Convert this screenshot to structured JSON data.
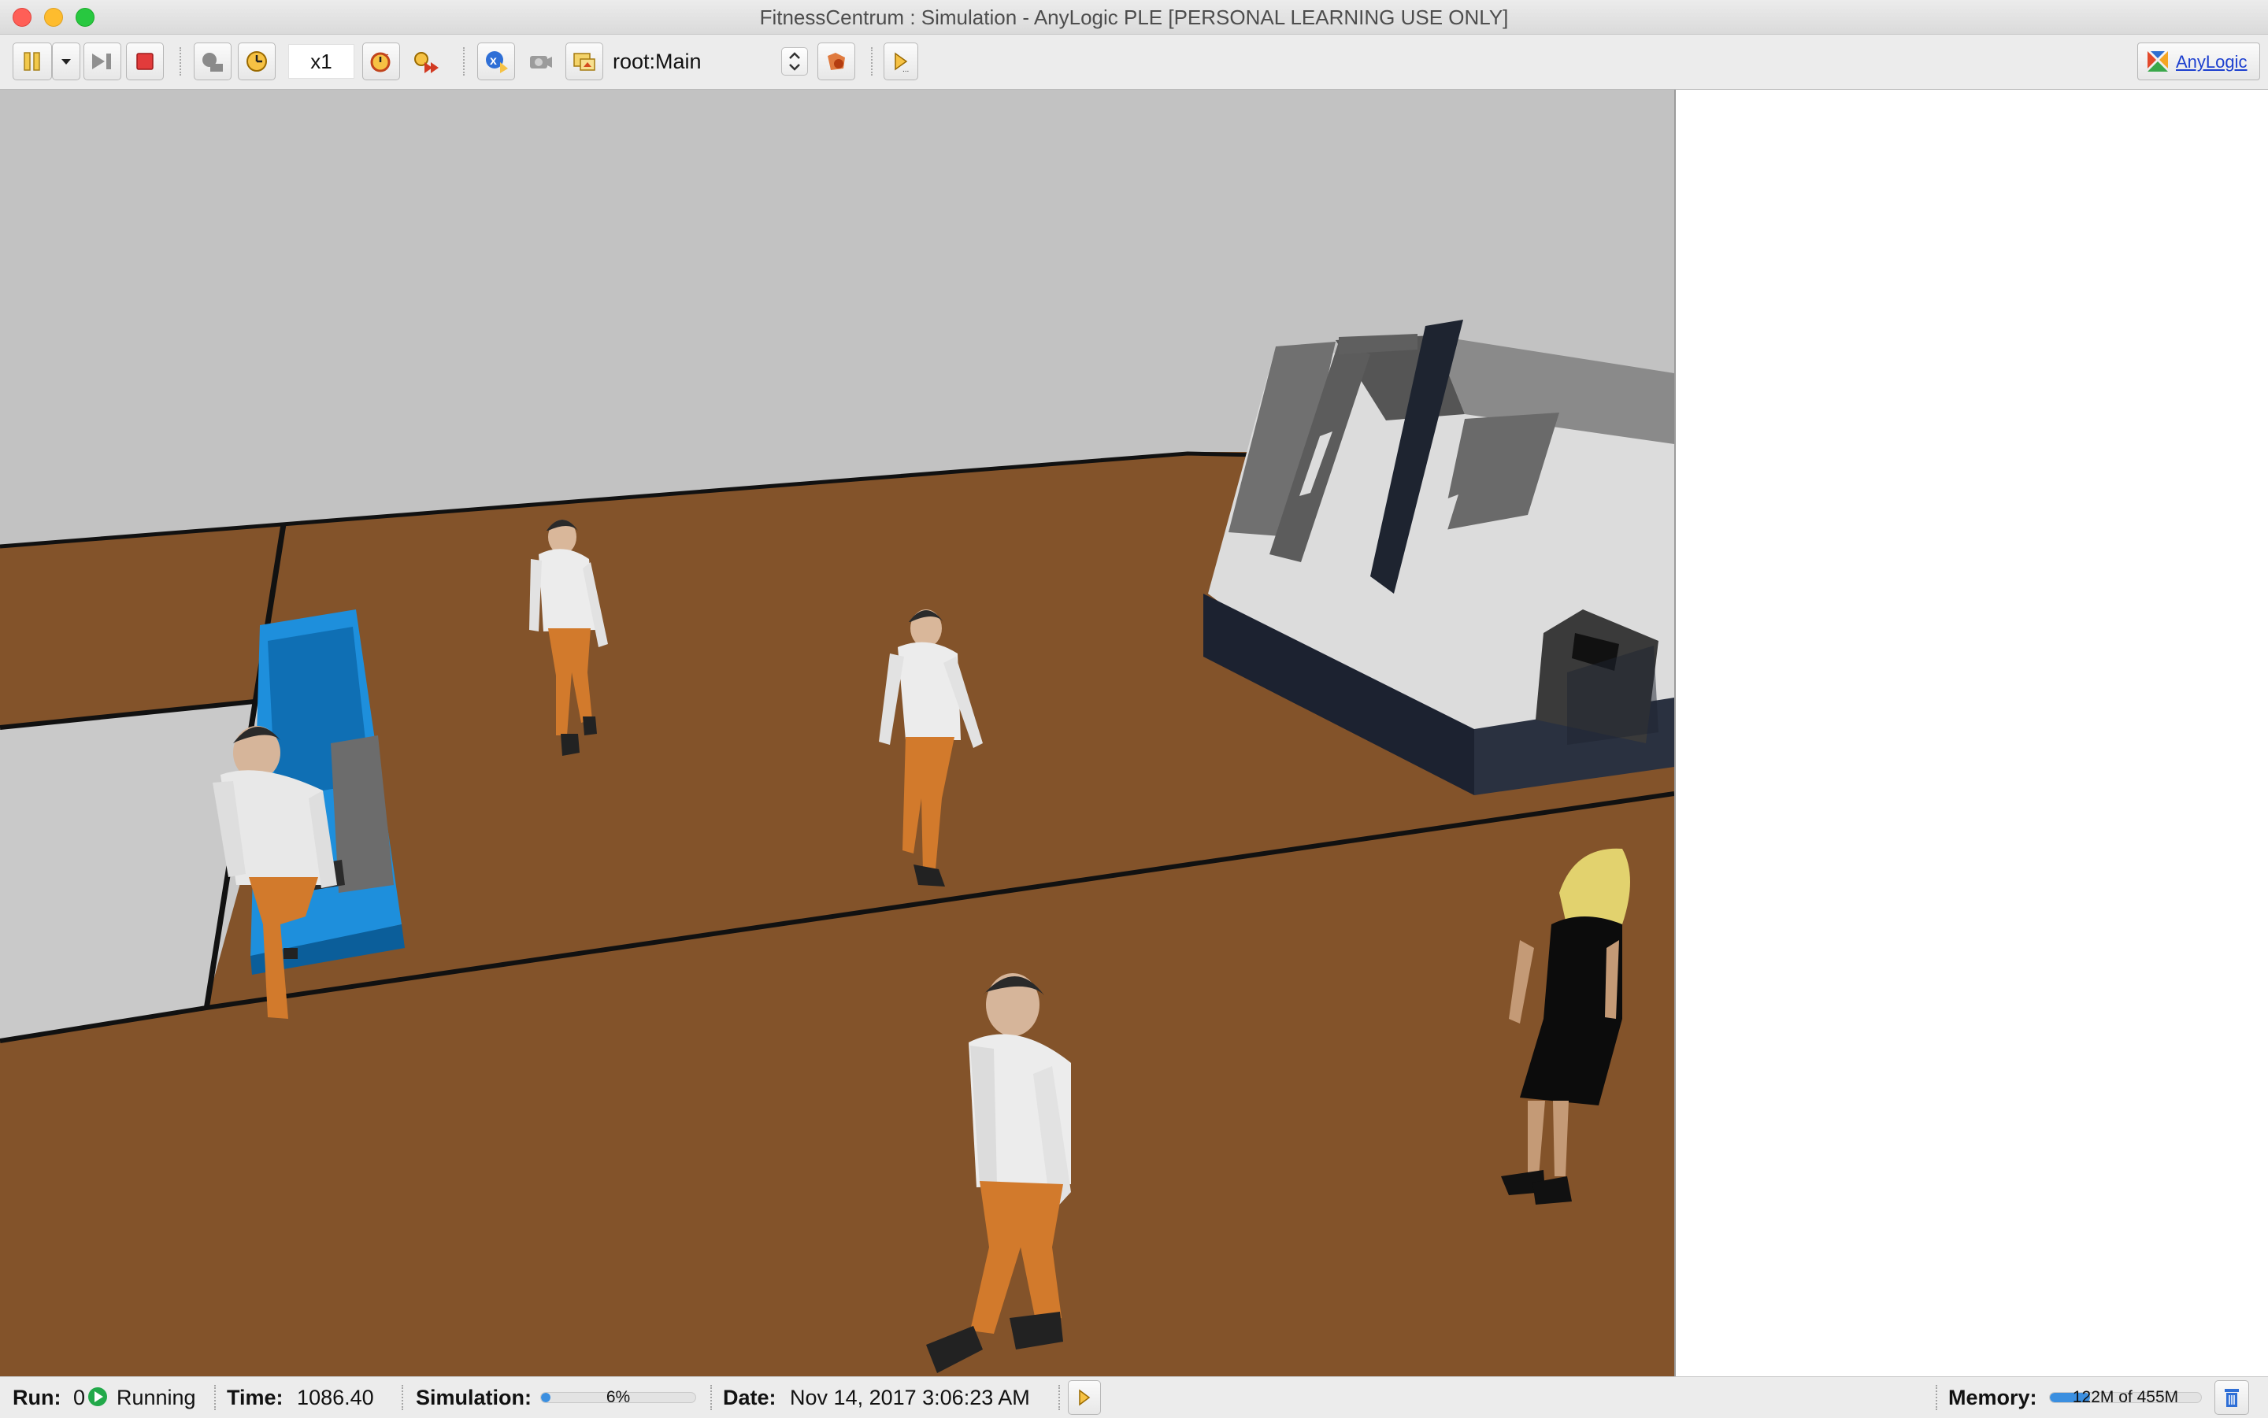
{
  "window": {
    "title": "FitnessCentrum : Simulation - AnyLogic PLE [PERSONAL LEARNING USE ONLY]"
  },
  "toolbar": {
    "speed": "x1",
    "agent_selector": "root:Main",
    "brand_link": "AnyLogic",
    "icons": [
      "run-pause-icon",
      "run-menu-chevron-icon",
      "step-icon",
      "stop-icon",
      "virtual-time-icon",
      "real-time-icon",
      "speed-slower-icon",
      "speed-faster-icon",
      "experiment-icon",
      "camera-icon",
      "navigate-up-icon",
      "navigate-to-agent-icon",
      "developer-panel-icon",
      "anylogic-logo-icon"
    ]
  },
  "status": {
    "run_label": "Run:",
    "run_value": "0",
    "state": "Running",
    "time_label": "Time:",
    "time_value": "1086.40",
    "simulation_label": "Simulation:",
    "simulation_progress_text": "6%",
    "simulation_progress": 0.06,
    "date_label": "Date:",
    "date_value": "Nov 14, 2017 3:06:23 AM",
    "memory_label": "Memory:",
    "memory_text": "122M of 455M",
    "memory_fraction": 0.268
  },
  "colors": {
    "floor": "#83532a",
    "wall": "#bfbfbf",
    "treadmill": "#1e8fdc",
    "machine_gray": "#6e6e6e",
    "progress_fill": "#3b8fe0",
    "stop_red": "#e23b3b"
  }
}
